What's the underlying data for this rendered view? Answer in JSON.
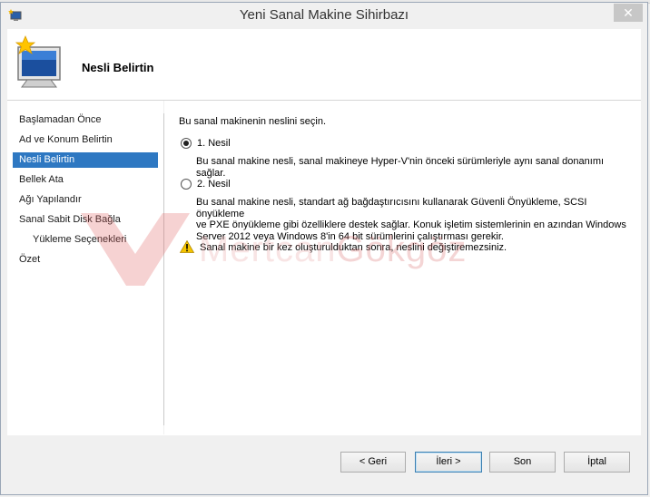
{
  "window": {
    "title": "Yeni Sanal Makine Sihirbazı",
    "close_label": "✕"
  },
  "header": {
    "title": "Nesli Belirtin"
  },
  "sidebar": {
    "items": [
      {
        "label": "Başlamadan Önce",
        "active": false
      },
      {
        "label": "Ad ve Konum Belirtin",
        "active": false
      },
      {
        "label": "Nesli Belirtin",
        "active": true
      },
      {
        "label": "Bellek Ata",
        "active": false
      },
      {
        "label": "Ağı Yapılandır",
        "active": false
      },
      {
        "label": "Sanal Sabit Disk Bağla",
        "active": false
      },
      {
        "label": "Yükleme Seçenekleri",
        "active": false
      },
      {
        "label": "Özet",
        "active": false
      }
    ]
  },
  "content": {
    "instruction": "Bu sanal makinenin neslini seçin.",
    "options": [
      {
        "label": "1. Nesil",
        "selected": true,
        "description": "Bu sanal makine nesli, sanal makineye Hyper-V'nin önceki sürümleriyle aynı sanal donanımı sağlar."
      },
      {
        "label": "2. Nesil",
        "selected": false,
        "description_lines": [
          "Bu sanal makine nesli, standart ağ bağdaştırıcısını kullanarak Güvenli Önyükleme, SCSI önyükleme",
          "ve PXE önyükleme gibi özelliklere destek sağlar. Konuk işletim sistemlerinin en azından Windows",
          "Server 2012 veya Windows 8'in 64 bit sürümlerini çalıştırması gerekir."
        ]
      }
    ],
    "warning": "Sanal makine bir kez oluşturulduktan sonra, neslini değiştiremezsiniz."
  },
  "watermark": {
    "text_part1": "Mertcan",
    "text_part2": "Gökgöz"
  },
  "buttons": {
    "back": "< Geri",
    "next": "İleri >",
    "finish": "Son",
    "cancel": "İptal"
  },
  "icons": {
    "title": "wizard-app-icon",
    "header": "computer-star-icon",
    "warning": "warning-triangle-icon"
  }
}
